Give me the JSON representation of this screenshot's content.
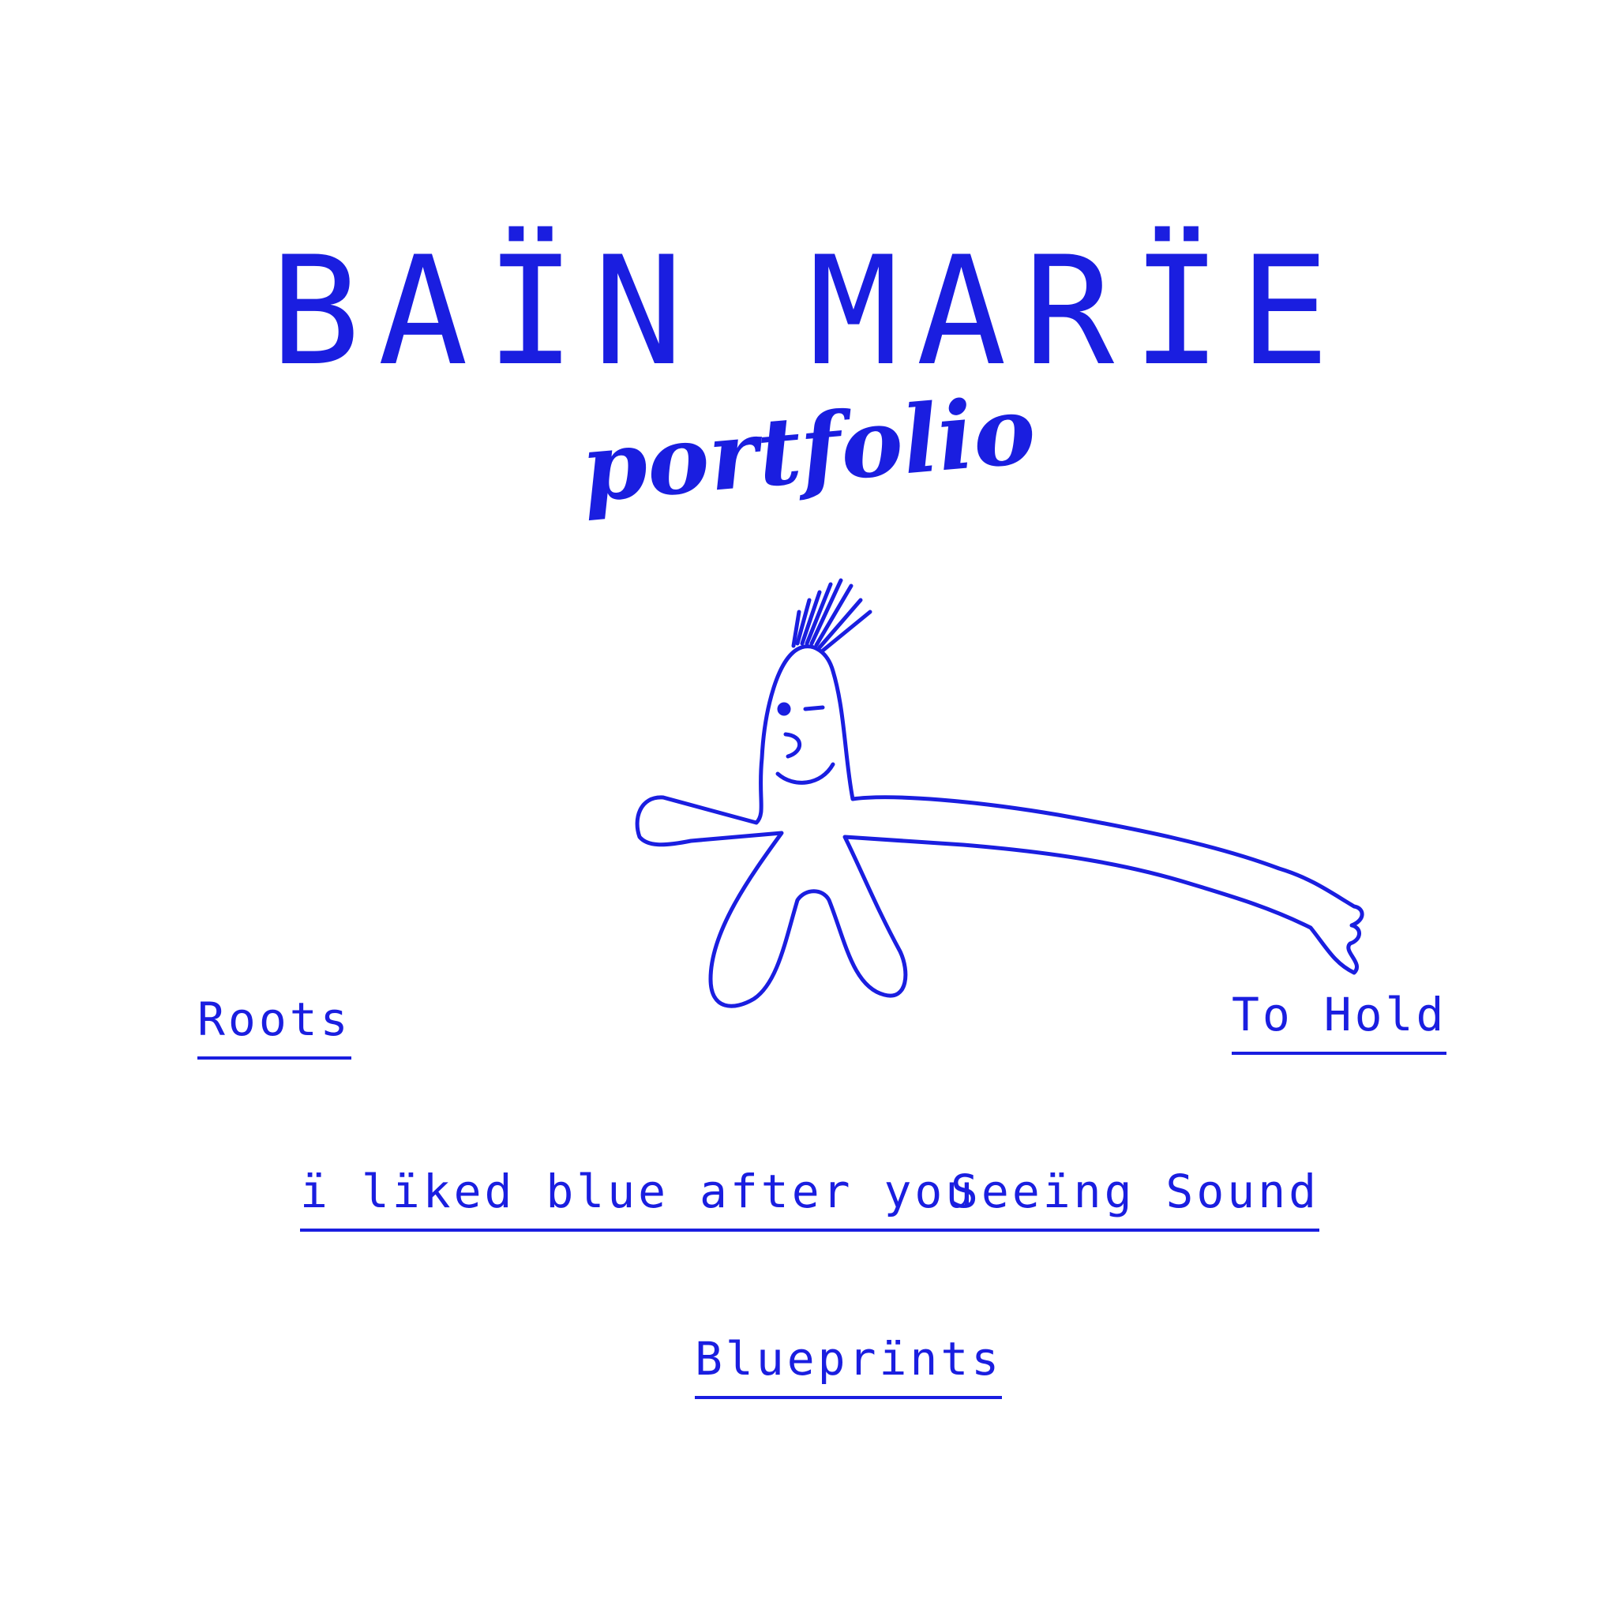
{
  "header": {
    "title": "BAÏN MARÏE",
    "subtitle": "portfolio"
  },
  "illustration": {
    "icon": "doodle-figure-icon",
    "color": "#1a1ee0"
  },
  "nav": {
    "links": [
      {
        "label": "Roots"
      },
      {
        "label": "To Hold"
      },
      {
        "label": "ï lïked blue after you"
      },
      {
        "label": "Seeïng Sound"
      },
      {
        "label": "Blueprïnts"
      }
    ]
  },
  "colors": {
    "accent": "#1a1ee0",
    "background": "#ffffff"
  }
}
